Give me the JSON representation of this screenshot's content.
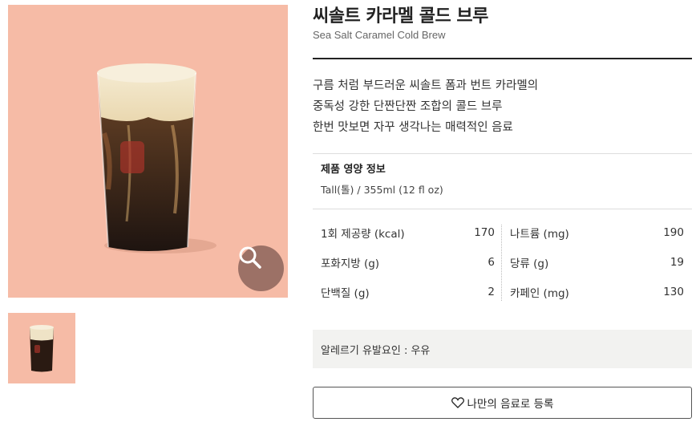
{
  "product": {
    "name_ko": "씨솔트 카라멜 콜드 브루",
    "name_en": "Sea Salt Caramel Cold Brew",
    "description": [
      "구름 처럼 부드러운 씨솔트 폼과 번트 카라멜의",
      "중독성 강한 단짠단짠 조합의 콜드 브루",
      "한번 맛보면 자꾸 생각나는 매력적인 음료"
    ]
  },
  "image": {
    "background_color": "#f6bba6",
    "zoom_icon": "magnifier-icon"
  },
  "nutrition": {
    "title": "제품 영양 정보",
    "size": "Tall(톨) / 355ml (12 fl oz)",
    "left": [
      {
        "label": "1회 제공량 (kcal)",
        "value": "170"
      },
      {
        "label": "포화지방 (g)",
        "value": "6"
      },
      {
        "label": "단백질 (g)",
        "value": "2"
      }
    ],
    "right": [
      {
        "label": "나트륨 (mg)",
        "value": "190"
      },
      {
        "label": "당류 (g)",
        "value": "19"
      },
      {
        "label": "카페인 (mg)",
        "value": "130"
      }
    ]
  },
  "allergy": "알레르기 유발요인 : 우유",
  "favorite_button": {
    "label": "나만의 음료로 등록",
    "icon": "heart-icon"
  }
}
